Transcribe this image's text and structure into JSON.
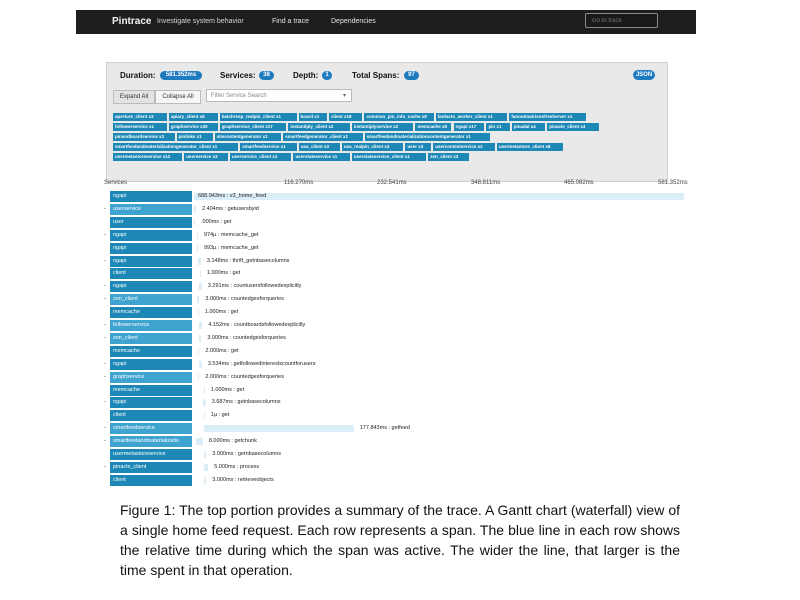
{
  "navbar": {
    "brand": "Pintrace",
    "tagline": "Investigate system behavior",
    "links": [
      "Find a trace",
      "Dependencies"
    ],
    "goto_placeholder": "Go to trace"
  },
  "summary": {
    "duration_label": "Duration:",
    "duration_value": "581.352ms",
    "services_label": "Services:",
    "services_value": "38",
    "depth_label": "Depth:",
    "depth_value": "1",
    "spans_label": "Total Spans:",
    "spans_value": "97",
    "json_label": "JSON",
    "expand_all": "Expand All",
    "collapse_all": "Collapse All",
    "filter_placeholder": "Filter Service Search",
    "service_tags": [
      [
        "aperture_client x3",
        "apiary_client x8",
        "batchresp_realpin_client x1",
        "board x1",
        "client x18",
        "common_pin_info_cache x8",
        "fanfacto_worker_client x1",
        "fanoutmatrixnofresherver x1"
      ],
      [
        "followerservice x1",
        "graphservice x30",
        "graphservice_client x17",
        "instantiply_client x2",
        "instantiplyservice x2",
        "memcache x8",
        "ngapi x17",
        "pin x1",
        "pinadal x4",
        "pinacle_client x4"
      ],
      [
        "pinandboardservice x3",
        "pinlinks x1",
        "sitecontentgenerator x1",
        "smartfeedgenerator_client x1",
        "smartfeedandmaterializationcontentgenerator x1"
      ],
      [
        "smartfeedandmaterializationgenerator_client x1",
        "smartfeedservice x1",
        "usa_client x3",
        "usa_realpin_client x3",
        "user x3",
        "usercontextservice x2",
        "usermetastore_client x8"
      ],
      [
        "usermetastoreservice x12",
        "userservice x3",
        "userservice_client x1",
        "userstateservice x1",
        "userstateservice_client x1",
        "zen_client x3"
      ]
    ]
  },
  "timeline": {
    "services_header": "Services",
    "ticks": [
      "116.270ms",
      "232.541ms",
      "348.811ms",
      "465.082ms",
      "581.352ms"
    ],
    "rows": [
      {
        "service": "ngapi",
        "expander": "",
        "label": "688.943ms : v3_home_feed",
        "start": 0.0,
        "span": 1.0
      },
      {
        "service": "userservice",
        "expander": "-",
        "label": "2.404ms : getusersbyid",
        "start": 0.0,
        "span": 0.004
      },
      {
        "service": "user",
        "expander": "",
        "label": ".000ms : get",
        "start": 0.0,
        "span": 0.002
      },
      {
        "service": "ngapi",
        "expander": "-",
        "label": "974µ : memcache_get",
        "start": 0.006,
        "span": 0.002
      },
      {
        "service": "ngapi",
        "expander": "",
        "label": "993µ : memcache_get",
        "start": 0.006,
        "span": 0.002
      },
      {
        "service": "ngapi",
        "expander": "-",
        "label": "3.148ms : thrift_getnbasecolumns",
        "start": 0.008,
        "span": 0.006
      },
      {
        "service": "client",
        "expander": "",
        "label": "1.000ms : get",
        "start": 0.012,
        "span": 0.002
      },
      {
        "service": "ngapi",
        "expander": "-",
        "label": "3.291ms : countusersfollowedexplicitly",
        "start": 0.01,
        "span": 0.006
      },
      {
        "service": "zen_client",
        "expander": "-",
        "label": "3.000ms : countedgesforqueries",
        "start": 0.006,
        "span": 0.005
      },
      {
        "service": "memcache",
        "expander": "",
        "label": "1.000ms : get",
        "start": 0.008,
        "span": 0.002
      },
      {
        "service": "followerservice",
        "expander": "-",
        "label": "4.152ms : countboardsfollowedexplicitly",
        "start": 0.01,
        "span": 0.007
      },
      {
        "service": "zen_client",
        "expander": "-",
        "label": "3.000ms : countedgesforqueries",
        "start": 0.01,
        "span": 0.005
      },
      {
        "service": "memcache",
        "expander": "",
        "label": "2.000ms : get",
        "start": 0.008,
        "span": 0.003
      },
      {
        "service": "ngapi",
        "expander": "-",
        "label": "3.534ms : getfollowedinterestscountforusers",
        "start": 0.01,
        "span": 0.006
      },
      {
        "service": "graphservice",
        "expander": "-",
        "label": "2.000ms : countedgesforqueries",
        "start": 0.008,
        "span": 0.003
      },
      {
        "service": "memcache",
        "expander": "",
        "label": "1.000ms : get",
        "start": 0.02,
        "span": 0.002
      },
      {
        "service": "ngapi",
        "expander": "-",
        "label": "3.687ms : getnbasecolumns",
        "start": 0.018,
        "span": 0.006
      },
      {
        "service": "client",
        "expander": "",
        "label": "1µ : get",
        "start": 0.02,
        "span": 0.001
      },
      {
        "service": "smartfeedservice",
        "expander": "-",
        "label": "177.843ms : getfeed",
        "start": 0.02,
        "span": 0.306
      },
      {
        "service": "smartfeedandmaterializatio",
        "expander": "-",
        "label": "8.000ms : getchunk",
        "start": 0.004,
        "span": 0.014
      },
      {
        "service": "usermetastoreservice",
        "expander": "",
        "label": "3.000ms : getnbasecolumns",
        "start": 0.02,
        "span": 0.005
      },
      {
        "service": "pinacle_client",
        "expander": "-",
        "label": "5.000ms : process",
        "start": 0.02,
        "span": 0.009
      },
      {
        "service": "client",
        "expander": "",
        "label": "3.000ms : retrieveobjects",
        "start": 0.02,
        "span": 0.005
      }
    ]
  },
  "caption": "Figure 1: The top portion provides a summary of the trace. A Gantt chart (waterfall) view of a single home feed request. Each row represents a span. The blue line in each row shows the relative time during which the span was active. The wider the line, that larger is the time spent in that operation."
}
